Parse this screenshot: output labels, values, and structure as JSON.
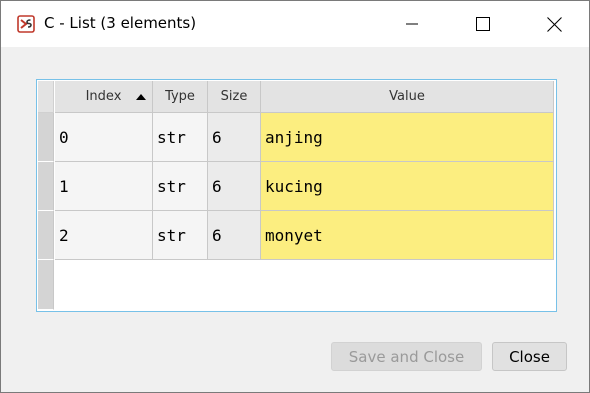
{
  "window": {
    "title": "C - List (3 elements)",
    "icon": "spyder-variable-explorer-icon"
  },
  "table": {
    "columns": [
      "Index",
      "Type",
      "Size",
      "Value"
    ],
    "sorted_column": "Index",
    "sort_direction": "ascending",
    "rows": [
      {
        "index": "0",
        "type": "str",
        "size": "6",
        "value": "anjing"
      },
      {
        "index": "1",
        "type": "str",
        "size": "6",
        "value": "kucing"
      },
      {
        "index": "2",
        "type": "str",
        "size": "6",
        "value": "monyet"
      }
    ]
  },
  "buttons": {
    "save_and_close": "Save and Close",
    "close": "Close"
  },
  "colors": {
    "value_cell": "#fcee80",
    "frame_border": "#77c1e8"
  }
}
